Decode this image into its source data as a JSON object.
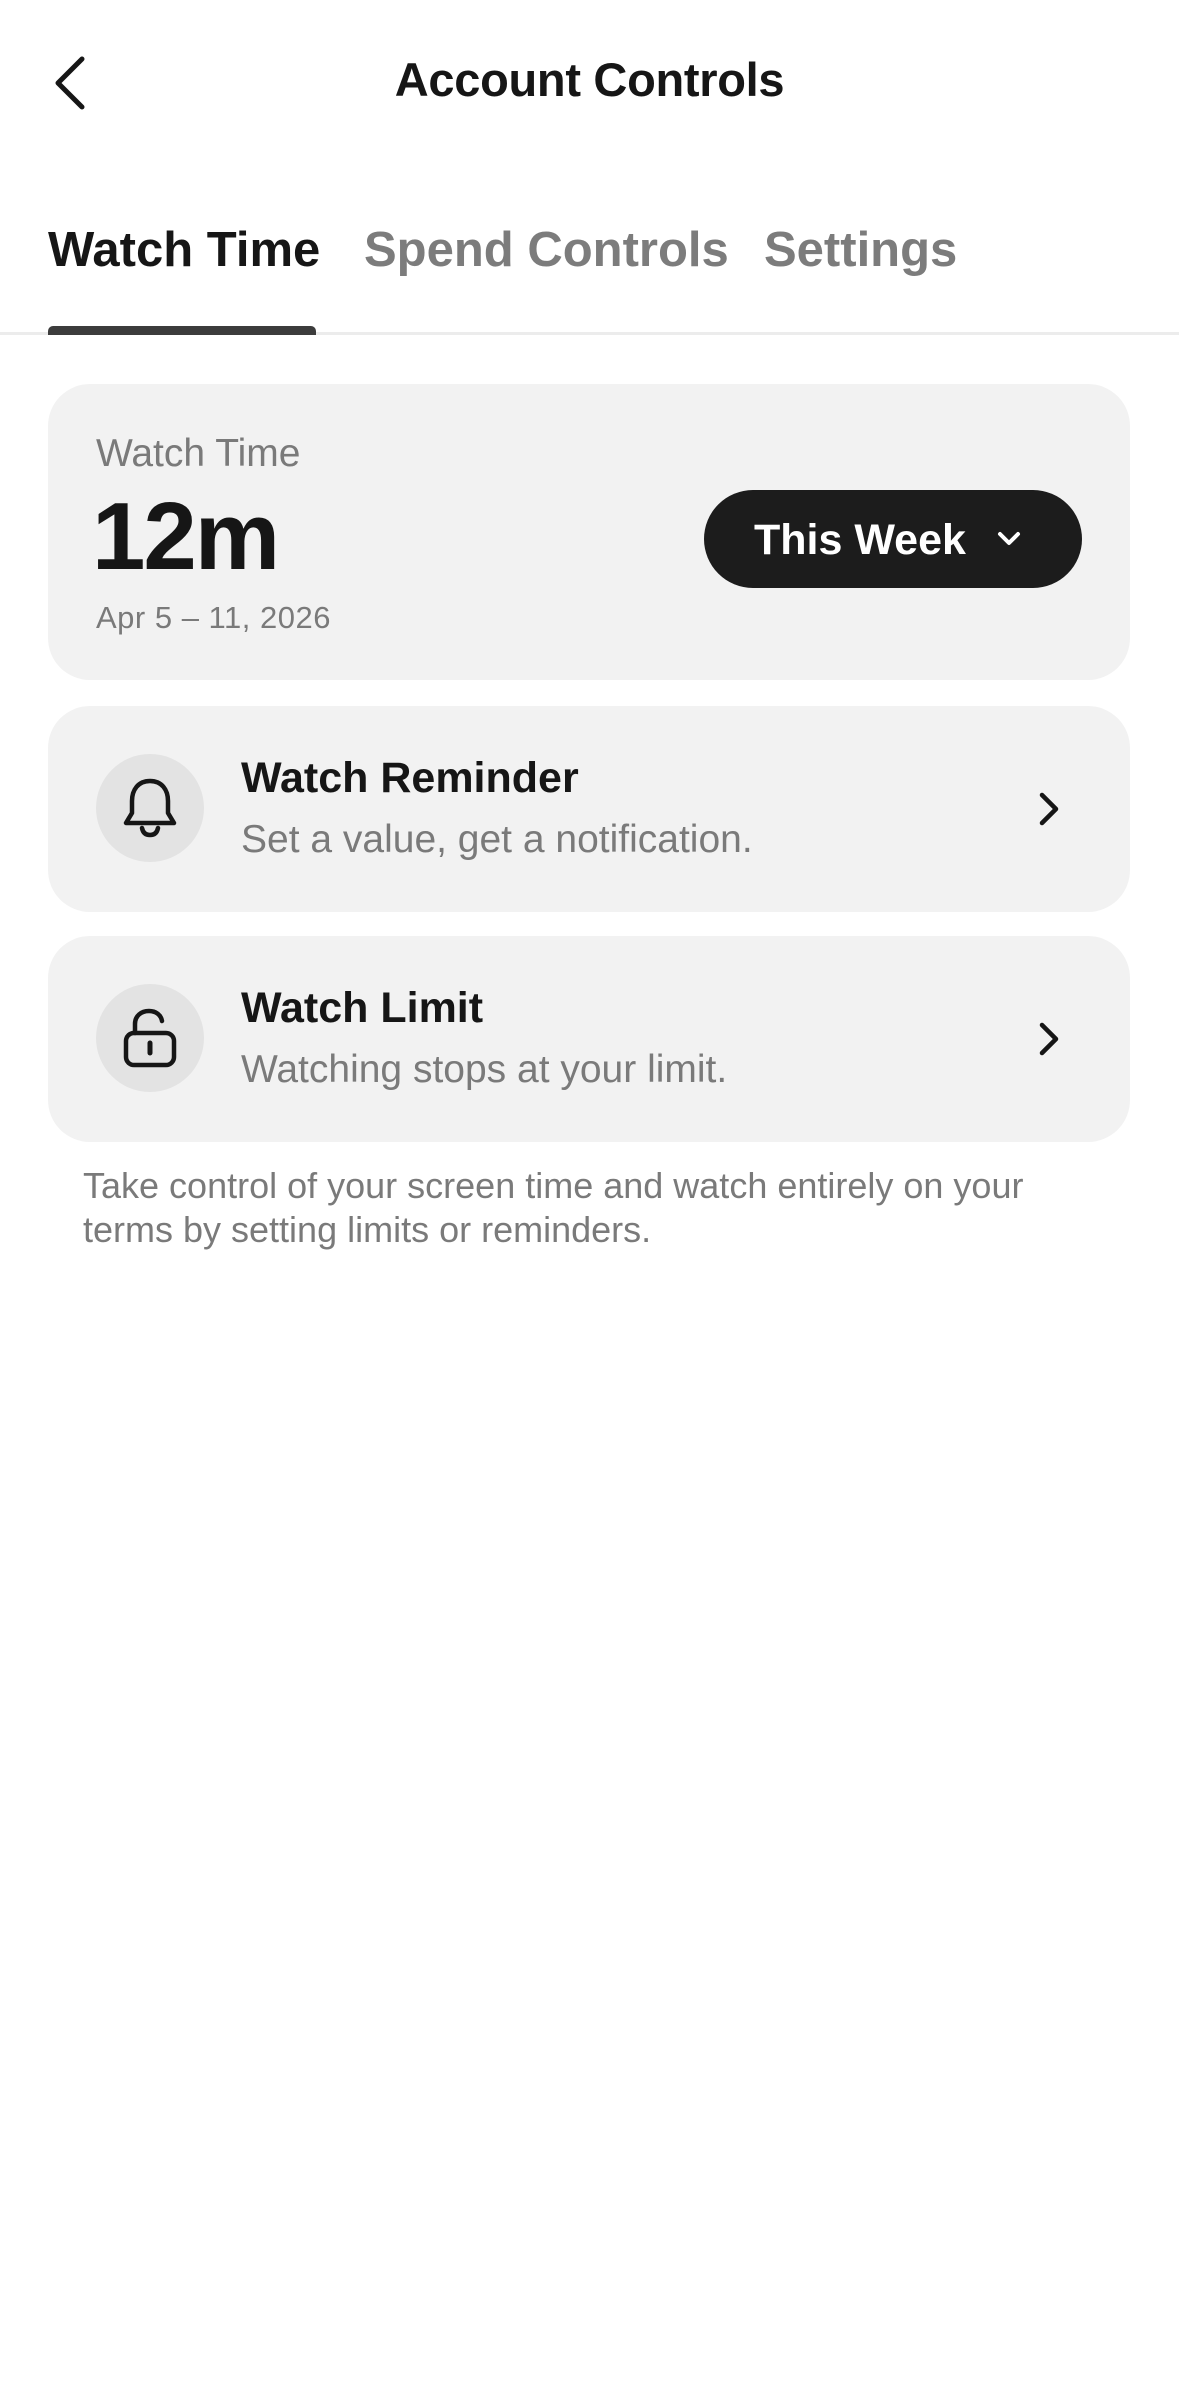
{
  "header": {
    "title": "Account Controls",
    "back_icon": "chevron-left-icon"
  },
  "tabs": [
    {
      "label": "Watch Time",
      "active": true
    },
    {
      "label": "Spend Controls",
      "active": false
    },
    {
      "label": "Settings",
      "active": false
    }
  ],
  "summary": {
    "label": "Watch Time",
    "value": "12m",
    "range": "Apr 5 – 11, 2026",
    "period": {
      "selected": "This Week",
      "icon": "chevron-down-icon"
    }
  },
  "options": [
    {
      "title": "Watch Reminder",
      "subtitle": "Set a value, get a notification.",
      "icon": "bell-icon"
    },
    {
      "title": "Watch Limit",
      "subtitle": "Watching stops at your limit.",
      "icon": "lock-icon"
    }
  ],
  "footnote": "Take control of your screen time and watch entirely on your terms by setting limits or reminders.",
  "colors": {
    "background": "#ffffff",
    "card": "#f2f2f2",
    "primary_text": "#161616",
    "secondary_text": "#7a7a7a",
    "button_dark": "#1c1c1c",
    "icon_circle": "#e3e3e3"
  }
}
